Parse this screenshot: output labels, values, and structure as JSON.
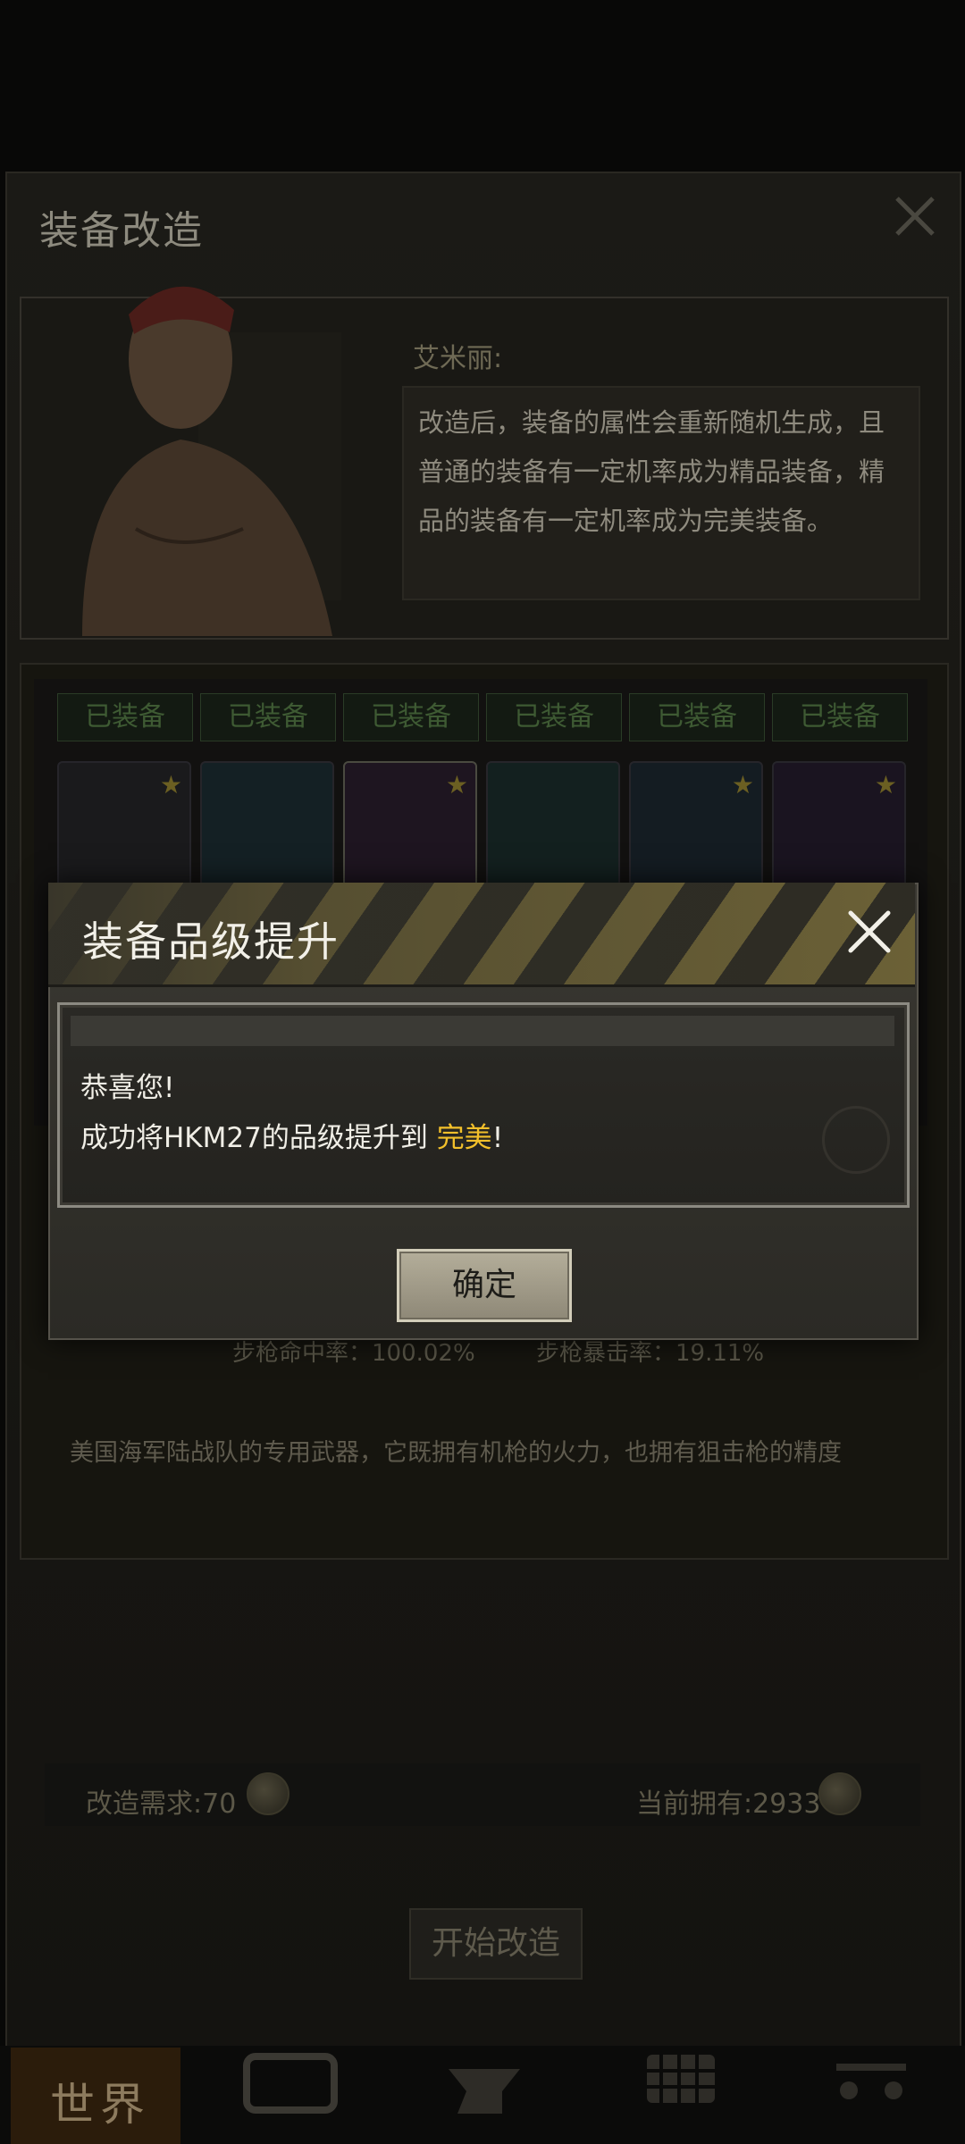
{
  "background": {
    "title": "装备改造",
    "npc": {
      "name": "艾米丽:",
      "speech": "改造后，装备的属性会重新随机生成，且普通的装备有一定机率成为精品装备，精品的装备有一定机率成为完美装备。"
    },
    "equipped_tags": [
      "已装备",
      "已装备",
      "已装备",
      "已装备",
      "已装备",
      "已装备"
    ],
    "stats": {
      "left": "步枪命中率：100.02%",
      "right": "步枪暴击率：19.11%"
    },
    "item_description": "美国海军陆战队的专用武器，它既拥有机枪的火力，也拥有狙击枪的精度",
    "cost_label": "改造需求:70",
    "owned_label": "当前拥有:2933",
    "start_button": "开始改造",
    "nav": {
      "world_label": "世界"
    }
  },
  "dialog": {
    "title": "装备品级提升",
    "message_line1": "恭喜您!",
    "message_line2_prefix": "成功将HKM27的品级提升到 ",
    "message_highlight": "完美",
    "message_line2_suffix": "!",
    "confirm_label": "确定"
  },
  "colors": {
    "highlight": "#f2c02b",
    "hazard_yellow": "#8a7b3e"
  }
}
